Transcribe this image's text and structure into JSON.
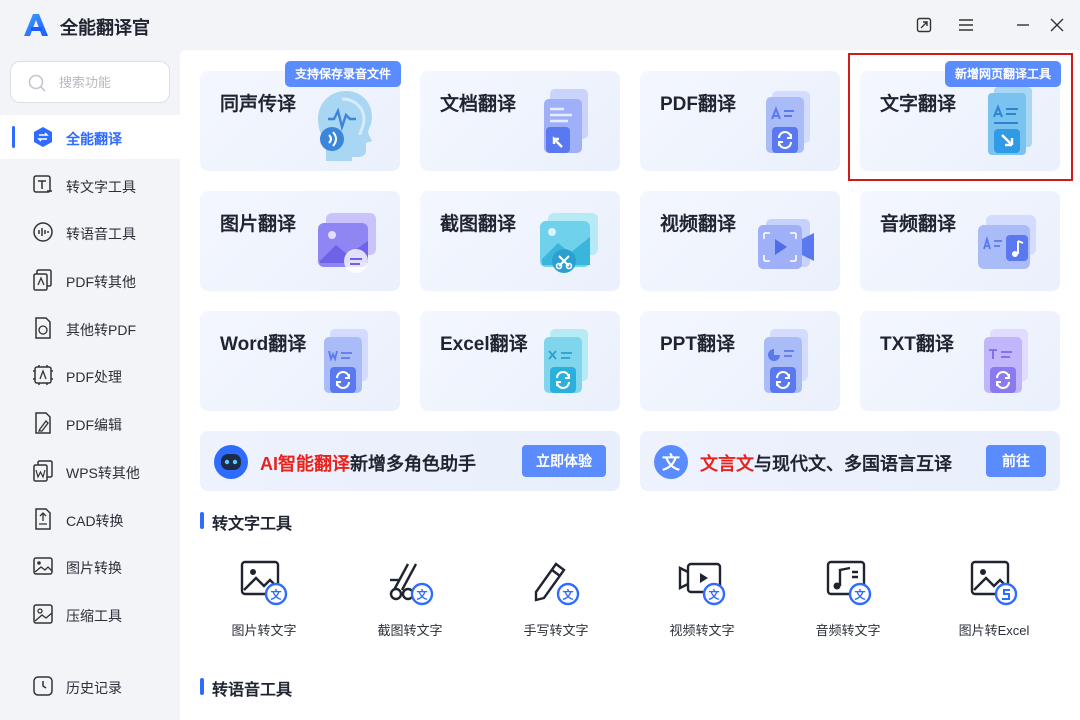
{
  "app": {
    "title": "全能翻译官"
  },
  "sidebar": {
    "search_placeholder": "搜索功能",
    "items": [
      {
        "label": "全能翻译",
        "icon": "translate-icon",
        "active": true
      },
      {
        "label": "转文字工具",
        "icon": "text-tool-icon"
      },
      {
        "label": "转语音工具",
        "icon": "voice-tool-icon"
      },
      {
        "label": "PDF转其他",
        "icon": "pdf-export-icon"
      },
      {
        "label": "其他转PDF",
        "icon": "pdf-import-icon"
      },
      {
        "label": "PDF处理",
        "icon": "pdf-process-icon"
      },
      {
        "label": "PDF编辑",
        "icon": "pdf-edit-icon"
      },
      {
        "label": "WPS转其他",
        "icon": "wps-convert-icon"
      },
      {
        "label": "CAD转换",
        "icon": "cad-convert-icon"
      },
      {
        "label": "图片转换",
        "icon": "image-convert-icon"
      },
      {
        "label": "压缩工具",
        "icon": "compress-icon"
      }
    ],
    "history_label": "历史记录"
  },
  "cards": [
    {
      "title": "同声传译",
      "badge": "支持保存录音文件",
      "icon": "head-voice-icon"
    },
    {
      "title": "文档翻译",
      "icon": "document-icon"
    },
    {
      "title": "PDF翻译",
      "icon": "pdf-translate-icon"
    },
    {
      "title": "文字翻译",
      "badge": "新增网页翻译工具",
      "icon": "text-translate-icon"
    },
    {
      "title": "图片翻译",
      "icon": "image-icon"
    },
    {
      "title": "截图翻译",
      "icon": "screenshot-icon"
    },
    {
      "title": "视频翻译",
      "icon": "video-icon"
    },
    {
      "title": "音频翻译",
      "icon": "audio-icon"
    },
    {
      "title": "Word翻译",
      "icon": "word-icon"
    },
    {
      "title": "Excel翻译",
      "icon": "excel-icon"
    },
    {
      "title": "PPT翻译",
      "icon": "ppt-icon"
    },
    {
      "title": "TXT翻译",
      "icon": "txt-icon"
    }
  ],
  "banners": [
    {
      "highlight": "AI智能翻译",
      "text": "新增多角色助手",
      "button": "立即体验",
      "icon": "robot-icon"
    },
    {
      "highlight": "文言文",
      "text": "与现代文、多国语言互译",
      "button": "前往",
      "icon": "wen-icon"
    }
  ],
  "sections": {
    "text_tools": "转文字工具",
    "voice_tools": "转语音工具"
  },
  "text_tools": [
    {
      "label": "图片转文字",
      "icon": "image-to-text-icon"
    },
    {
      "label": "截图转文字",
      "icon": "screenshot-to-text-icon"
    },
    {
      "label": "手写转文字",
      "icon": "handwriting-to-text-icon"
    },
    {
      "label": "视频转文字",
      "icon": "video-to-text-icon"
    },
    {
      "label": "音频转文字",
      "icon": "audio-to-text-icon"
    },
    {
      "label": "图片转Excel",
      "icon": "image-to-excel-icon"
    }
  ],
  "colors": {
    "accent": "#2f6bff",
    "badge": "#5b8cff",
    "highlight_text": "#e8231d",
    "highlight_box": "#d11a1a"
  }
}
